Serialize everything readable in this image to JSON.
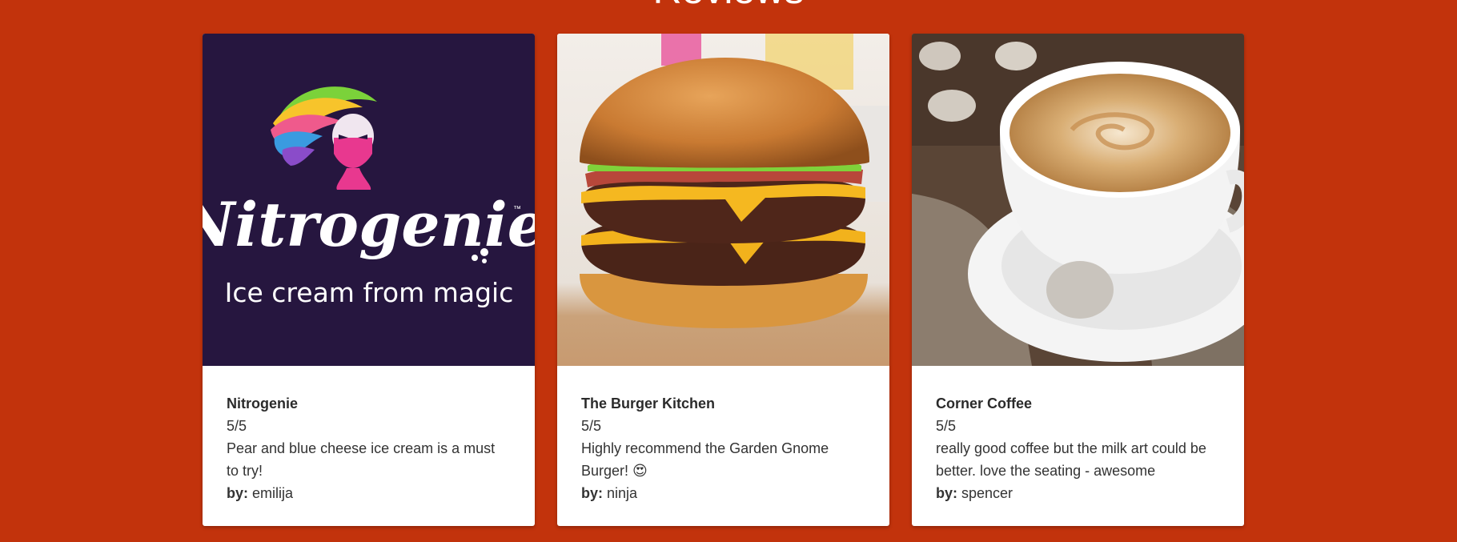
{
  "page": {
    "heading": "Reviews",
    "background": "#c2330c"
  },
  "cards": [
    {
      "title": "Nitrogenie",
      "rating": "5/5",
      "body": "Pear and blue cheese ice cream is a must to try!",
      "by_label": "by:",
      "author": "emilija",
      "image": {
        "brand": "Nitrogenie",
        "trademark": "™",
        "tagline": "Ice cream from magic",
        "background": "#26163f"
      }
    },
    {
      "title": "The Burger Kitchen",
      "rating": "5/5",
      "body": "Highly recommend the Garden Gnome Burger! 😍",
      "by_label": "by:",
      "author": "ninja",
      "image": {
        "subject": "double cheeseburger"
      }
    },
    {
      "title": "Corner Coffee",
      "rating": "5/5",
      "body": "really good coffee but the milk art could be better. love the seating - awesome",
      "by_label": "by:",
      "author": "spencer",
      "image": {
        "subject": "cappuccino cup"
      }
    }
  ]
}
